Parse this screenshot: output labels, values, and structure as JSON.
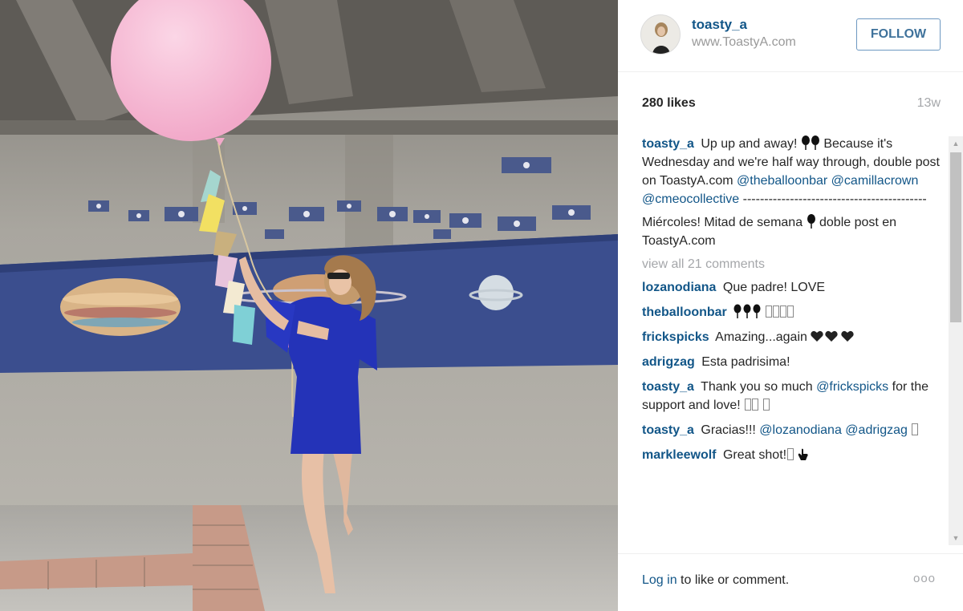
{
  "post": {
    "username": "toasty_a",
    "website": "www.ToastyA.com",
    "follow_label": "FOLLOW",
    "likes": "280 likes",
    "time_ago": "13w"
  },
  "caption": {
    "author": "toasty_a",
    "line1_text": "Up up and away!",
    "line1_rest": "Because it's Wednesday and we're half way through, double post on ToastyA.com",
    "mention1": "@theballoonbar",
    "mention2": "@camillacrown",
    "mention3": "@cmeocollective",
    "divider": "-------------------------------------------",
    "spanish_a": "Miércoles! Mitad de semana",
    "spanish_b": "doble post en ToastyA.com"
  },
  "view_all": "view all 21 comments",
  "comments": [
    {
      "author": "lozanodiana",
      "text": "Que padre! LOVE"
    },
    {
      "author": "theballoonbar",
      "text": ""
    },
    {
      "author": "frickspicks",
      "text": "Amazing...again"
    },
    {
      "author": "adrigzag",
      "text": "Esta padrisima!"
    },
    {
      "author": "toasty_a",
      "text": "Thank you so much",
      "mention": "@frickspicks",
      "text2": "for the support and love!"
    },
    {
      "author": "toasty_a",
      "text": "Gracias!!!",
      "mention": "@lozanodiana",
      "mention2": "@adrigzag"
    },
    {
      "author": "markleewolf",
      "text": "Great shot!"
    }
  ],
  "footer": {
    "login_link": "Log in",
    "login_rest": " to like or comment.",
    "more": "ooo"
  },
  "icons": {
    "balloon": "black-balloon-icon",
    "hearts": "heart-icon",
    "pointing_hand": "pointing-hand-icon",
    "more": "more-options-icon"
  },
  "colors": {
    "link": "#125688",
    "follow_text": "#3f729b",
    "muted": "#a5a7aa"
  }
}
